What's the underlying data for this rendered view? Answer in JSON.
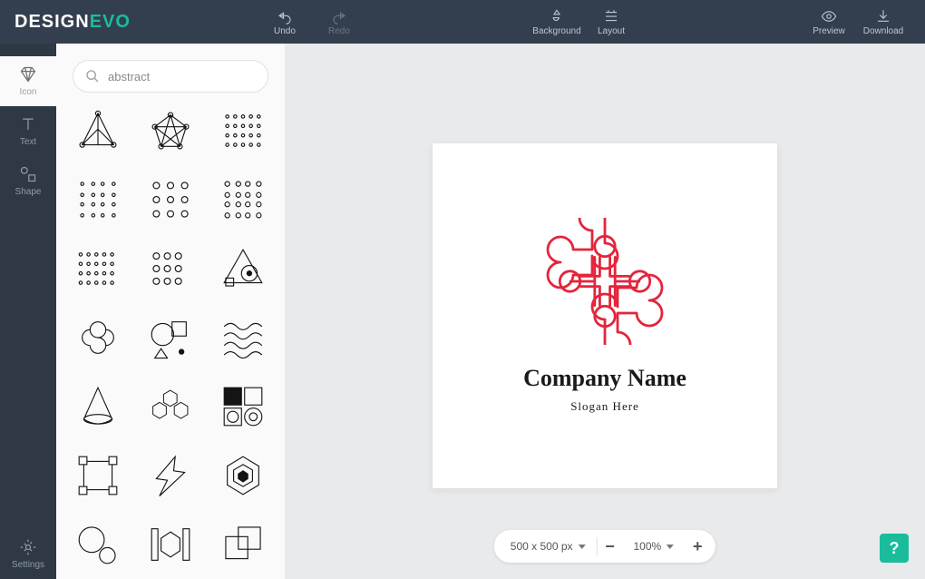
{
  "brand": {
    "left": "DESIGN",
    "right": "EVO"
  },
  "topbar": {
    "undo": "Undo",
    "redo": "Redo",
    "background": "Background",
    "layout": "Layout",
    "preview": "Preview",
    "download": "Download"
  },
  "leftnav": {
    "icon": "Icon",
    "text": "Text",
    "shape": "Shape",
    "settings": "Settings"
  },
  "search": {
    "value": "abstract"
  },
  "canvas": {
    "company": "Company Name",
    "slogan": "Slogan Here"
  },
  "zoom": {
    "size": "500 x 500 px",
    "level": "100%"
  },
  "help": "?",
  "icons": {
    "triangle": "triangle-network-icon",
    "atom": "star-node-icon",
    "dots1": "dot-grid-icon",
    "dots2": "dot-grid-b-icon",
    "circle-grid": "circle-grid-icon",
    "circle-grid2": "circle-grid-b-icon",
    "dots-small": "dot-rows-icon",
    "circles-row": "circles-rows-icon",
    "eye-triangle": "triangle-eye-icon",
    "knot": "knot-icon",
    "shapes-combo": "shapes-combo-icon",
    "waves": "waves-icon",
    "cone": "cone-icon",
    "cubes": "cube-stack-icon",
    "quad-shapes": "quad-target-icon",
    "crop": "crop-frame-icon",
    "bolt": "lightning-icon",
    "hex": "hex-nest-icon",
    "two-circles": "two-circles-icon",
    "bar-hex": "hex-bars-icon",
    "overlap-sq": "overlap-squares-icon"
  }
}
